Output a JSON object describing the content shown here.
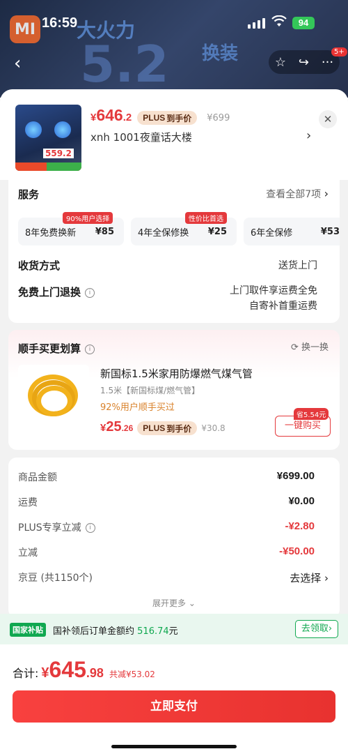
{
  "status": {
    "time": "16:59",
    "battery": "94"
  },
  "background": {
    "title": "大火力",
    "big_number": "5.2",
    "sub": "换装"
  },
  "header_actions": {
    "badge": "5+"
  },
  "product": {
    "price_symbol": "¥",
    "price_int": "646",
    "price_dec": ".2",
    "plus_p": "PLUS",
    "plus_label": "到手价",
    "original_price": "¥699",
    "thumb_price": "559.2",
    "address": "xnh  1001夜童话大楼"
  },
  "service": {
    "title": "服务",
    "view_all": "查看全部7项",
    "options": [
      {
        "tag": "90%用户选择",
        "label": "8年免费换新",
        "amount": "¥85"
      },
      {
        "tag": "性价比首选",
        "label": "4年全保修换",
        "amount": "¥25"
      },
      {
        "tag": "",
        "label": "6年全保修",
        "amount": "¥53"
      }
    ],
    "delivery_label": "收货方式",
    "delivery_value": "送货上门",
    "return_label": "免费上门退换",
    "return_value_1": "上门取件享运费全免",
    "return_value_2": "自寄补首重运费"
  },
  "addon": {
    "title": "顺手买更划算",
    "swap": "换一换",
    "name": "新国标1.5米家用防爆燃气煤气管",
    "spec": "1.5米【新国标煤/燃气管】",
    "rate": "92%用户顺手买过",
    "price_symbol": "¥",
    "price_int": "25",
    "price_dec": ".26",
    "plus_p": "PLUS",
    "plus_label": "到手价",
    "original_price": "¥30.8",
    "save_tag": "省5.54元",
    "buy_label": "一键购买"
  },
  "summary": {
    "rows": [
      {
        "label": "商品金额",
        "value": "¥699.00"
      },
      {
        "label": "运费",
        "value": "¥0.00"
      },
      {
        "label": "PLUS专享立减",
        "value": "-¥2.80"
      },
      {
        "label": "立减",
        "value": "-¥50.00"
      },
      {
        "label": "京豆 (共1150个)",
        "value": "去选择"
      }
    ],
    "expand": "展开更多"
  },
  "subsidy": {
    "tag": "国家补贴",
    "text": "国补领后订单金额约",
    "amount": "516.74",
    "unit": "元",
    "button": "去领取"
  },
  "footer": {
    "total_label": "合计:",
    "price_symbol": "¥",
    "price_int": "645",
    "price_dec": ".98",
    "saved": "共减¥53.02",
    "pay_button": "立即支付"
  },
  "colors": {
    "accent_red": "#e4393c",
    "subsidy_green": "#10a850",
    "plus_bg": "#f7e1cf"
  }
}
